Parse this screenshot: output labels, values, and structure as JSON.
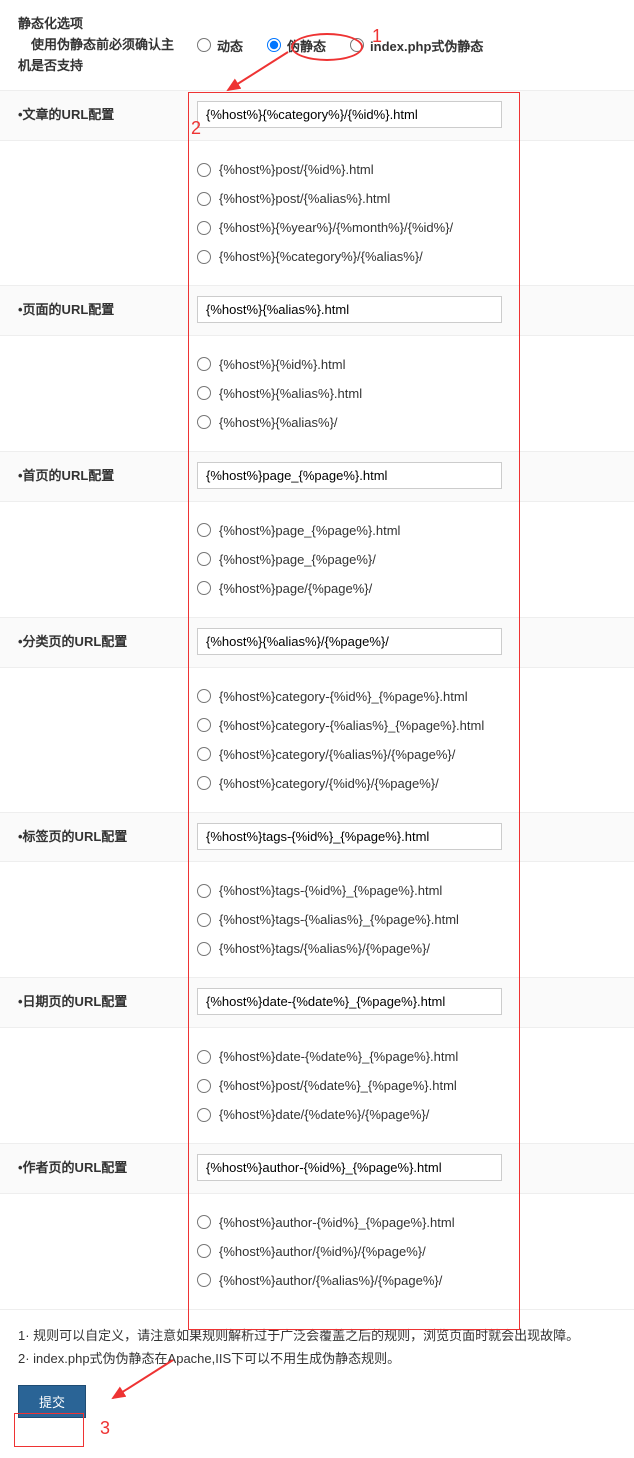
{
  "header": {
    "title_line1": "静态化选项",
    "title_line2": "　使用伪静态前必须确认主机是否支持",
    "mode_options": {
      "dynamic": "动态",
      "pseudo": "伪静态",
      "indexphp": "index.php式伪静态"
    }
  },
  "sections": {
    "article": {
      "label": "•文章的URL配置",
      "value": "{%host%}{%category%}/{%id%}.html",
      "options": [
        "{%host%}post/{%id%}.html",
        "{%host%}post/{%alias%}.html",
        "{%host%}{%year%}/{%month%}/{%id%}/",
        "{%host%}{%category%}/{%alias%}/"
      ]
    },
    "page": {
      "label": "•页面的URL配置",
      "value": "{%host%}{%alias%}.html",
      "options": [
        "{%host%}{%id%}.html",
        "{%host%}{%alias%}.html",
        "{%host%}{%alias%}/"
      ]
    },
    "index": {
      "label": "•首页的URL配置",
      "value": "{%host%}page_{%page%}.html",
      "options": [
        "{%host%}page_{%page%}.html",
        "{%host%}page_{%page%}/",
        "{%host%}page/{%page%}/"
      ]
    },
    "category": {
      "label": "•分类页的URL配置",
      "value": "{%host%}{%alias%}/{%page%}/",
      "options": [
        "{%host%}category-{%id%}_{%page%}.html",
        "{%host%}category-{%alias%}_{%page%}.html",
        "{%host%}category/{%alias%}/{%page%}/",
        "{%host%}category/{%id%}/{%page%}/"
      ]
    },
    "tag": {
      "label": "•标签页的URL配置",
      "value": "{%host%}tags-{%id%}_{%page%}.html",
      "options": [
        "{%host%}tags-{%id%}_{%page%}.html",
        "{%host%}tags-{%alias%}_{%page%}.html",
        "{%host%}tags/{%alias%}/{%page%}/"
      ]
    },
    "date": {
      "label": "•日期页的URL配置",
      "value": "{%host%}date-{%date%}_{%page%}.html",
      "options": [
        "{%host%}date-{%date%}_{%page%}.html",
        "{%host%}post/{%date%}_{%page%}.html",
        "{%host%}date/{%date%}/{%page%}/"
      ]
    },
    "author": {
      "label": "•作者页的URL配置",
      "value": "{%host%}author-{%id%}_{%page%}.html",
      "options": [
        "{%host%}author-{%id%}_{%page%}.html",
        "{%host%}author/{%id%}/{%page%}/",
        "{%host%}author/{%alias%}/{%page%}/"
      ]
    }
  },
  "notes": {
    "n1": "1· 规则可以自定义，请注意如果规则解析过于广泛会覆盖之后的规则，浏览页面时就会出现故障。",
    "n2": "2· index.php式伪伪静态在Apache,IIS下可以不用生成伪静态规则。"
  },
  "submit": "提交",
  "ann": {
    "m1": "1",
    "m2": "2",
    "m3": "3"
  }
}
